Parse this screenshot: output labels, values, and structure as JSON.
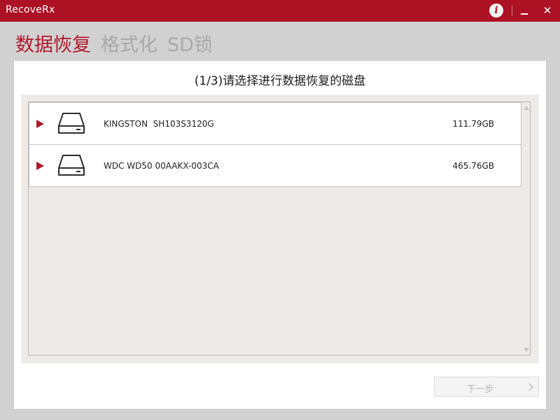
{
  "window": {
    "app_name": "RecoveRx",
    "info_icon": "i",
    "close_icon": "✕"
  },
  "mode_tabs": [
    {
      "label": "数据恢复",
      "active": true
    },
    {
      "label": "格式化",
      "active": false
    },
    {
      "label": "SD锁",
      "active": false
    }
  ],
  "step_title": "(1/3)请选择进行数据恢复的磁盘",
  "disks": [
    {
      "name": "KINGSTON  SH103S3120G",
      "size": "111.79GB",
      "icon": "hard-drive-icon"
    },
    {
      "name": "WDC WD50 00AAKX-003CA",
      "size": "465.76GB",
      "icon": "hard-drive-icon"
    }
  ],
  "next_button": {
    "label": "下一步",
    "enabled": false
  },
  "colors": {
    "brand_red": "#ac1124",
    "active_tab": "#b01a2c",
    "inactive_tab": "#a9a9a9",
    "list_background": "#eeeae8"
  }
}
